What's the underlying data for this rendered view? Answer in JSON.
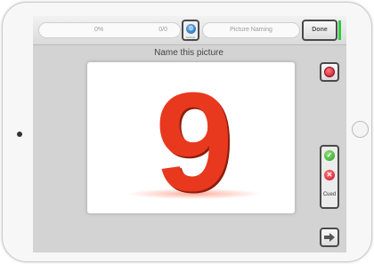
{
  "topbar": {
    "progress_percent": "0%",
    "progress_count": "0/0",
    "settings_label": "Settings",
    "task_name": "Picture Naming",
    "done_label": "Done"
  },
  "prompt": "Name this picture",
  "picture": {
    "digit": "9"
  },
  "scoring": {
    "correct_icon": "✓",
    "incorrect_icon": "✕",
    "cued_label": "Cued"
  },
  "icons": {
    "settings": "gear-icon",
    "record": "record-icon",
    "next": "arrow-right-icon"
  },
  "colors": {
    "accent_blue": "#1f66b0",
    "correct_green": "#2e9a1f",
    "incorrect_red": "#c8102e",
    "done_indicator": "#2ecc40",
    "digit_red": "#e8391f"
  }
}
